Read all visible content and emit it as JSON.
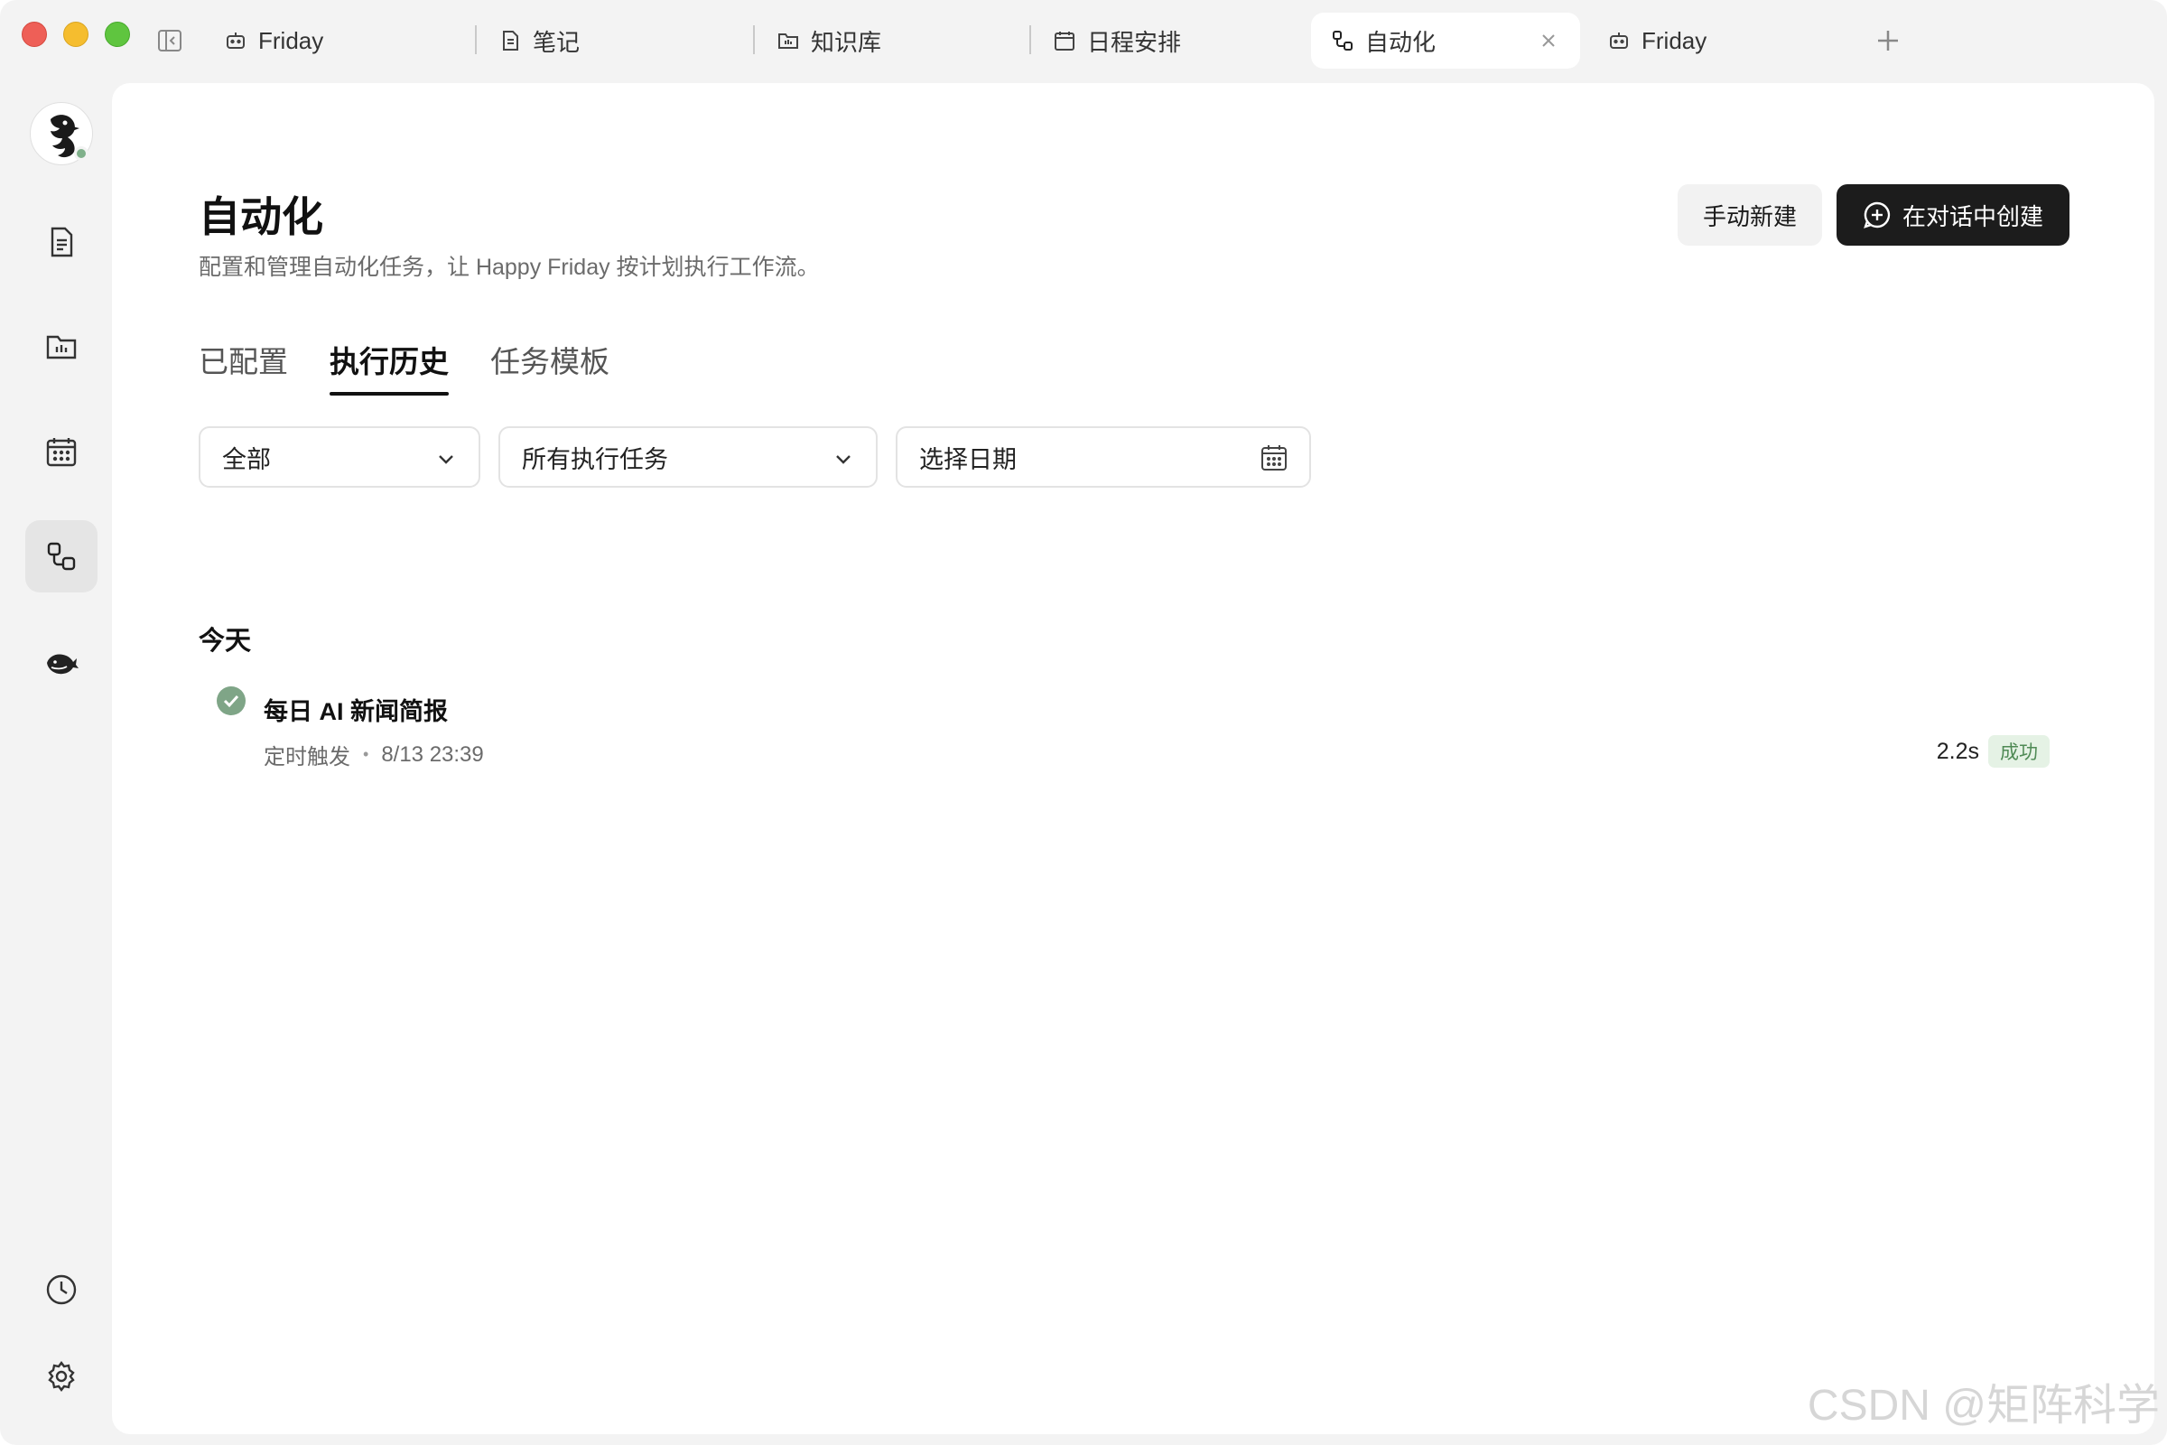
{
  "window": {
    "tabs": [
      {
        "label": "Friday",
        "icon": "robot-icon"
      },
      {
        "label": "笔记",
        "icon": "document-icon"
      },
      {
        "label": "知识库",
        "icon": "folder-icon"
      },
      {
        "label": "日程安排",
        "icon": "calendar-icon"
      },
      {
        "label": "自动化",
        "icon": "automation-icon",
        "active": true
      },
      {
        "label": "Friday",
        "icon": "robot-icon"
      }
    ]
  },
  "header": {
    "title": "自动化",
    "subtitle": "配置和管理自动化任务，让 Happy Friday 按计划执行工作流。",
    "manual_button": "手动新建",
    "chat_button": "在对话中创建"
  },
  "subtabs": [
    "已配置",
    "执行历史",
    "任务模板"
  ],
  "filters": {
    "status": "全部",
    "task": "所有执行任务",
    "date_placeholder": "选择日期"
  },
  "history": {
    "section": "今天",
    "runs": [
      {
        "title": "每日 AI 新闻简报",
        "trigger": "定时触发",
        "time": "8/13 23:39",
        "duration": "2.2s",
        "status": "成功"
      }
    ]
  },
  "watermark": "CSDN @矩阵科学",
  "colors": {
    "accent_dark": "#1c1c1c",
    "success_green": "#7fa587",
    "success_badge_bg": "#e5f2e5"
  }
}
